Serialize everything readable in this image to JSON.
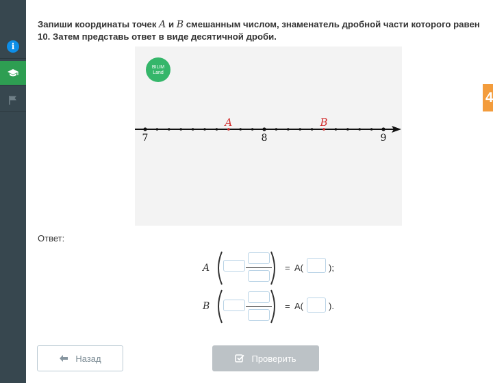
{
  "task": {
    "part1": "Запиши координаты точек",
    "var_a": "A",
    "and": "и",
    "var_b": "B",
    "part2": "смешанным числом, знаменатель дробной части которого равен 10. Затем представь ответ в виде десятичной дроби."
  },
  "logo": {
    "line1": "BILIM",
    "line2": "Land"
  },
  "number_line": {
    "ticks": [
      7,
      8,
      9
    ],
    "divisions_per_unit": 10,
    "points": [
      {
        "name": "A",
        "value": 7.7
      },
      {
        "name": "B",
        "value": 8.5
      }
    ],
    "point_color": "#d32f2f"
  },
  "answer": {
    "label": "Ответ:",
    "rows": [
      {
        "var": "A",
        "eq": "=",
        "decimal_var": "A(",
        "suffix": ");"
      },
      {
        "var": "B",
        "eq": "=",
        "decimal_var": "A(",
        "suffix": ")."
      }
    ]
  },
  "buttons": {
    "back": "Назад",
    "check": "Проверить"
  },
  "side_tab_text": "4",
  "colors": {
    "sidebar": "#37474f",
    "active": "#2e9e52",
    "info": "#0d8ee8",
    "disabled_button": "#bcc2c6",
    "edge_tab": "#f39c3c"
  },
  "icons": [
    "info-icon",
    "graduation-cap-icon",
    "flag-icon",
    "arrow-left-icon",
    "check-square-icon"
  ]
}
